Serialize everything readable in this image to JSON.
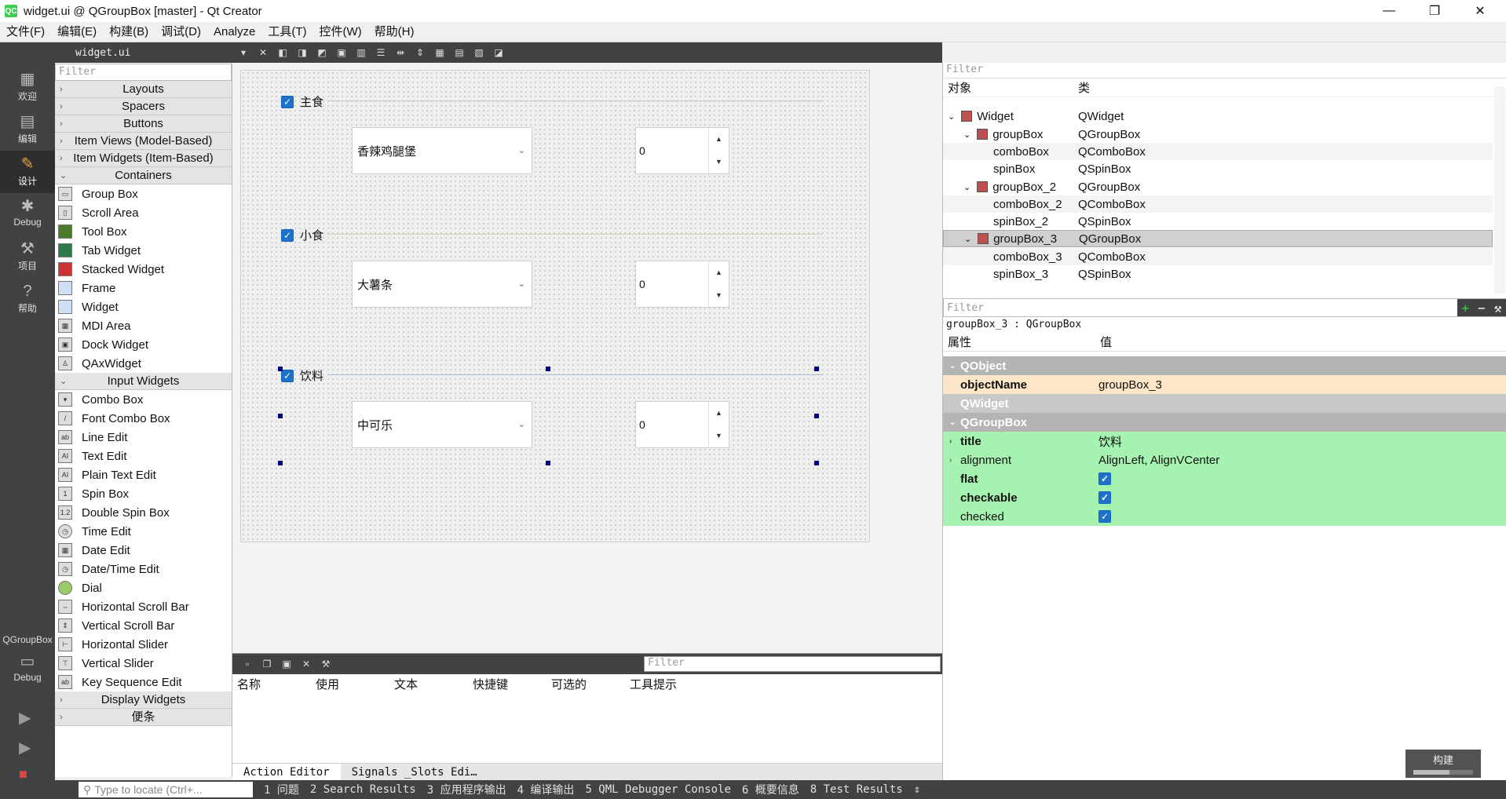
{
  "window": {
    "title": "widget.ui @ QGroupBox [master] - Qt Creator",
    "app_icon": "QC",
    "minimize": "—",
    "maximize": "❐",
    "close": "✕"
  },
  "menu": [
    "文件(F)",
    "编辑(E)",
    "构建(B)",
    "调试(D)",
    "Analyze",
    "工具(T)",
    "控件(W)",
    "帮助(H)"
  ],
  "modes": [
    {
      "label": "欢迎",
      "icon": "grid-icon",
      "glyph": "▦"
    },
    {
      "label": "编辑",
      "icon": "edit-icon",
      "glyph": "▤"
    },
    {
      "label": "设计",
      "icon": "design-icon",
      "glyph": "✎"
    },
    {
      "label": "Debug",
      "icon": "debug-icon",
      "glyph": "✱"
    },
    {
      "label": "项目",
      "icon": "wrench-icon",
      "glyph": "⚒"
    },
    {
      "label": "帮助",
      "icon": "help-icon",
      "glyph": "?"
    }
  ],
  "kit": {
    "name": "QGroupBox",
    "mode": "Debug"
  },
  "editor_toolbar": {
    "file": "widget.ui"
  },
  "widget_box": {
    "filter_placeholder": "Filter",
    "categories_top": [
      "Layouts",
      "Spacers",
      "Buttons",
      "Item Views (Model-Based)",
      "Item Widgets (Item-Based)"
    ],
    "containers": {
      "label": "Containers",
      "items": [
        "Group Box",
        "Scroll Area",
        "Tool Box",
        "Tab Widget",
        "Stacked Widget",
        "Frame",
        "Widget",
        "MDI Area",
        "Dock Widget",
        "QAxWidget"
      ]
    },
    "input_widgets": {
      "label": "Input Widgets",
      "items": [
        "Combo Box",
        "Font Combo Box",
        "Line Edit",
        "Text Edit",
        "Plain Text Edit",
        "Spin Box",
        "Double Spin Box",
        "Time Edit",
        "Date Edit",
        "Date/Time Edit",
        "Dial",
        "Horizontal Scroll Bar",
        "Vertical Scroll Bar",
        "Horizontal Slider",
        "Vertical Slider",
        "Key Sequence Edit"
      ]
    },
    "categories_bottom": [
      "Display Widgets",
      "便条"
    ]
  },
  "form": {
    "groups": [
      {
        "title": "主食",
        "combo": "香辣鸡腿堡",
        "spin": "0"
      },
      {
        "title": "小食",
        "combo": "大薯条",
        "spin": "0"
      },
      {
        "title": "饮料",
        "combo": "中可乐",
        "spin": "0"
      }
    ]
  },
  "action_editor": {
    "filter_placeholder": "Filter",
    "columns": [
      "名称",
      "使用",
      "文本",
      "快捷键",
      "可选的",
      "工具提示"
    ],
    "tabs": [
      "Action Editor",
      "Signals _Slots Edi…"
    ]
  },
  "object_inspector": {
    "filter_placeholder": "Filter",
    "columns": [
      "对象",
      "类"
    ],
    "rows": [
      {
        "name": "Widget",
        "class": "QWidget"
      },
      {
        "name": "groupBox",
        "class": "QGroupBox"
      },
      {
        "name": "comboBox",
        "class": "QComboBox"
      },
      {
        "name": "spinBox",
        "class": "QSpinBox"
      },
      {
        "name": "groupBox_2",
        "class": "QGroupBox"
      },
      {
        "name": "comboBox_2",
        "class": "QComboBox"
      },
      {
        "name": "spinBox_2",
        "class": "QSpinBox"
      },
      {
        "name": "groupBox_3",
        "class": "QGroupBox"
      },
      {
        "name": "comboBox_3",
        "class": "QComboBox"
      },
      {
        "name": "spinBox_3",
        "class": "QSpinBox"
      }
    ]
  },
  "property_editor": {
    "filter_placeholder": "Filter",
    "current": "groupBox_3 : QGroupBox",
    "columns": [
      "属性",
      "值"
    ],
    "sections": {
      "qobject": "QObject",
      "qwidget": "QWidget",
      "qgroupbox": "QGroupBox"
    },
    "props": {
      "objectName": {
        "name": "objectName",
        "value": "groupBox_3"
      },
      "title": {
        "name": "title",
        "value": "饮料"
      },
      "alignment": {
        "name": "alignment",
        "value": "AlignLeft, AlignVCenter"
      },
      "flat": {
        "name": "flat"
      },
      "checkable": {
        "name": "checkable"
      },
      "checked": {
        "name": "checked"
      }
    }
  },
  "statusbar": {
    "locator_placeholder": "Type to locate (Ctrl+...",
    "tabs": [
      "1 问题",
      "2 Search Results",
      "3 应用程序输出",
      "4 编译输出",
      "5 QML Debugger Console",
      "6 概要信息",
      "8 Test Results"
    ],
    "build_label": "构建"
  },
  "colors": {
    "selection": "#1e73c8",
    "property_green": "#a6f2b0",
    "handle": "#000080",
    "dark_bar": "#404244"
  }
}
